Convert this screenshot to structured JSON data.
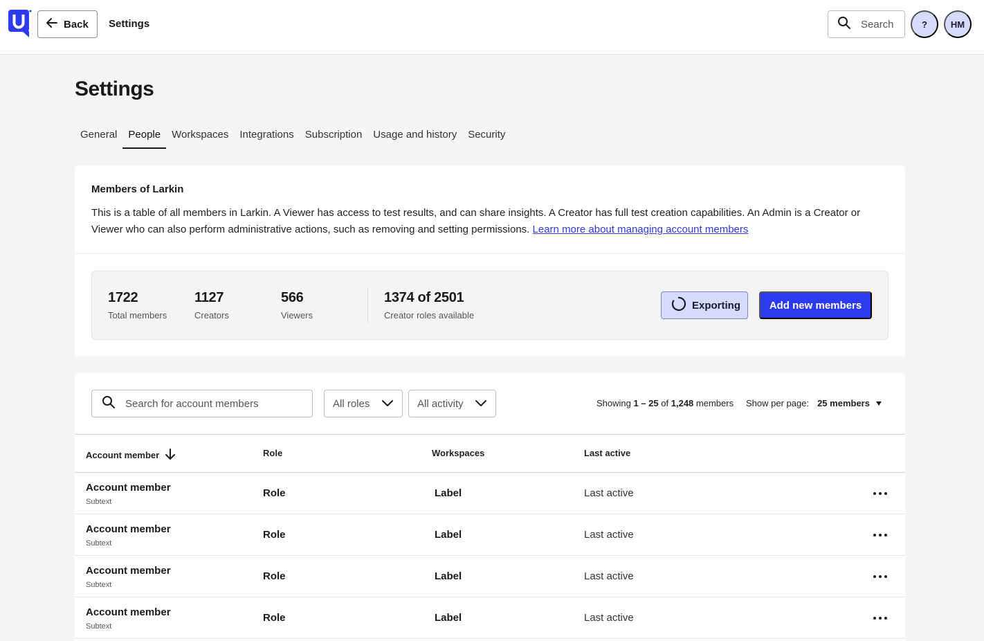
{
  "topbar": {
    "logo_letter": "U",
    "back_label": "Back",
    "title": "Settings",
    "search_label": "Search",
    "help_label": "?",
    "avatar_initials": "HM"
  },
  "page": {
    "title": "Settings"
  },
  "tabs": [
    {
      "label": "General",
      "active": false
    },
    {
      "label": "People",
      "active": true
    },
    {
      "label": "Workspaces",
      "active": false
    },
    {
      "label": "Integrations",
      "active": false
    },
    {
      "label": "Subscription",
      "active": false
    },
    {
      "label": "Usage and history",
      "active": false
    },
    {
      "label": "Security",
      "active": false
    }
  ],
  "members_card": {
    "heading": "Members of Larkin",
    "description": "This is a table of all members in Larkin. A Viewer has access to test results, and can share insights. A Creator has full test creation capabilities. An Admin is a Creator or Viewer who can also perform administrative actions, such as removing and setting permissions.",
    "link_text": "Learn more about managing account members"
  },
  "stats": {
    "total": {
      "value": "1722",
      "label": "Total members"
    },
    "creators": {
      "value": "1127",
      "label": "Creators"
    },
    "viewers": {
      "value": "566",
      "label": "Viewers"
    },
    "roles_available": {
      "value": "1374 of 2501",
      "label": "Creator roles available"
    },
    "export_label": "Exporting",
    "add_label": "Add new members"
  },
  "table_controls": {
    "search_placeholder": "Search for account members",
    "roles_filter": "All roles",
    "activity_filter": "All activity",
    "showing_prefix": "Showing",
    "showing_range": "1 – 25",
    "showing_of": "of",
    "showing_total": "1,248",
    "showing_suffix": "members",
    "per_page_label": "Show per page:",
    "per_page_value": "25 members"
  },
  "table": {
    "columns": [
      "Account member",
      "Role",
      "Workspaces",
      "Last active"
    ],
    "rows": [
      {
        "name": "Account member",
        "subtext": "Subtext",
        "role": "Role",
        "workspace": "Label",
        "last_active": "Last active"
      },
      {
        "name": "Account member",
        "subtext": "Subtext",
        "role": "Role",
        "workspace": "Label",
        "last_active": "Last active"
      },
      {
        "name": "Account member",
        "subtext": "Subtext",
        "role": "Role",
        "workspace": "Label",
        "last_active": "Last active"
      },
      {
        "name": "Account member",
        "subtext": "Subtext",
        "role": "Role",
        "workspace": "Label",
        "last_active": "Last active"
      }
    ]
  },
  "colors": {
    "primary": "#2d3bf0",
    "primary_light": "#d6dbfb",
    "link": "#2d3bd9",
    "background": "#f5f5f5"
  },
  "icons": {
    "logo": "brand-logo-icon",
    "back": "arrow-left-icon",
    "search": "search-icon",
    "spinner": "spinner-icon",
    "chevron": "chevron-down-icon",
    "sort": "arrow-down-icon",
    "caret": "caret-down-icon",
    "more": "more-horizontal-icon"
  }
}
